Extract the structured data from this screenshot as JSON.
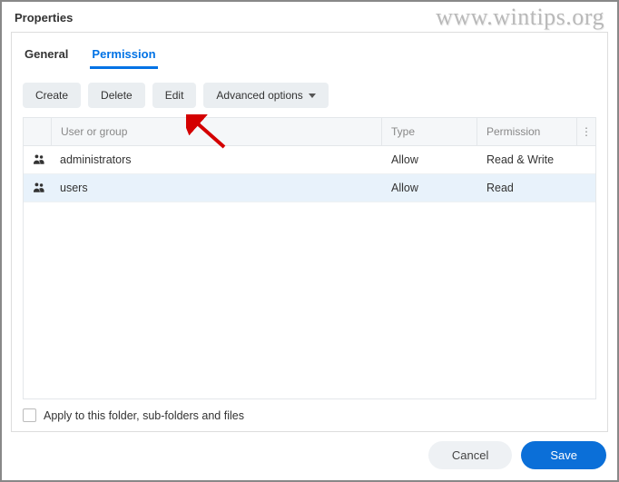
{
  "watermark": "www.wintips.org",
  "title": "Properties",
  "tabs": {
    "general": "General",
    "permission": "Permission"
  },
  "toolbar": {
    "create": "Create",
    "delete": "Delete",
    "edit": "Edit",
    "advanced": "Advanced options"
  },
  "table": {
    "headers": {
      "user": "User or group",
      "type": "Type",
      "permission": "Permission",
      "more": "⋮"
    },
    "rows": [
      {
        "name": "administrators",
        "type": "Allow",
        "permission": "Read & Write",
        "selected": false
      },
      {
        "name": "users",
        "type": "Allow",
        "permission": "Read",
        "selected": true
      }
    ]
  },
  "applyLabel": "Apply to this folder, sub-folders and files",
  "footer": {
    "cancel": "Cancel",
    "save": "Save"
  }
}
